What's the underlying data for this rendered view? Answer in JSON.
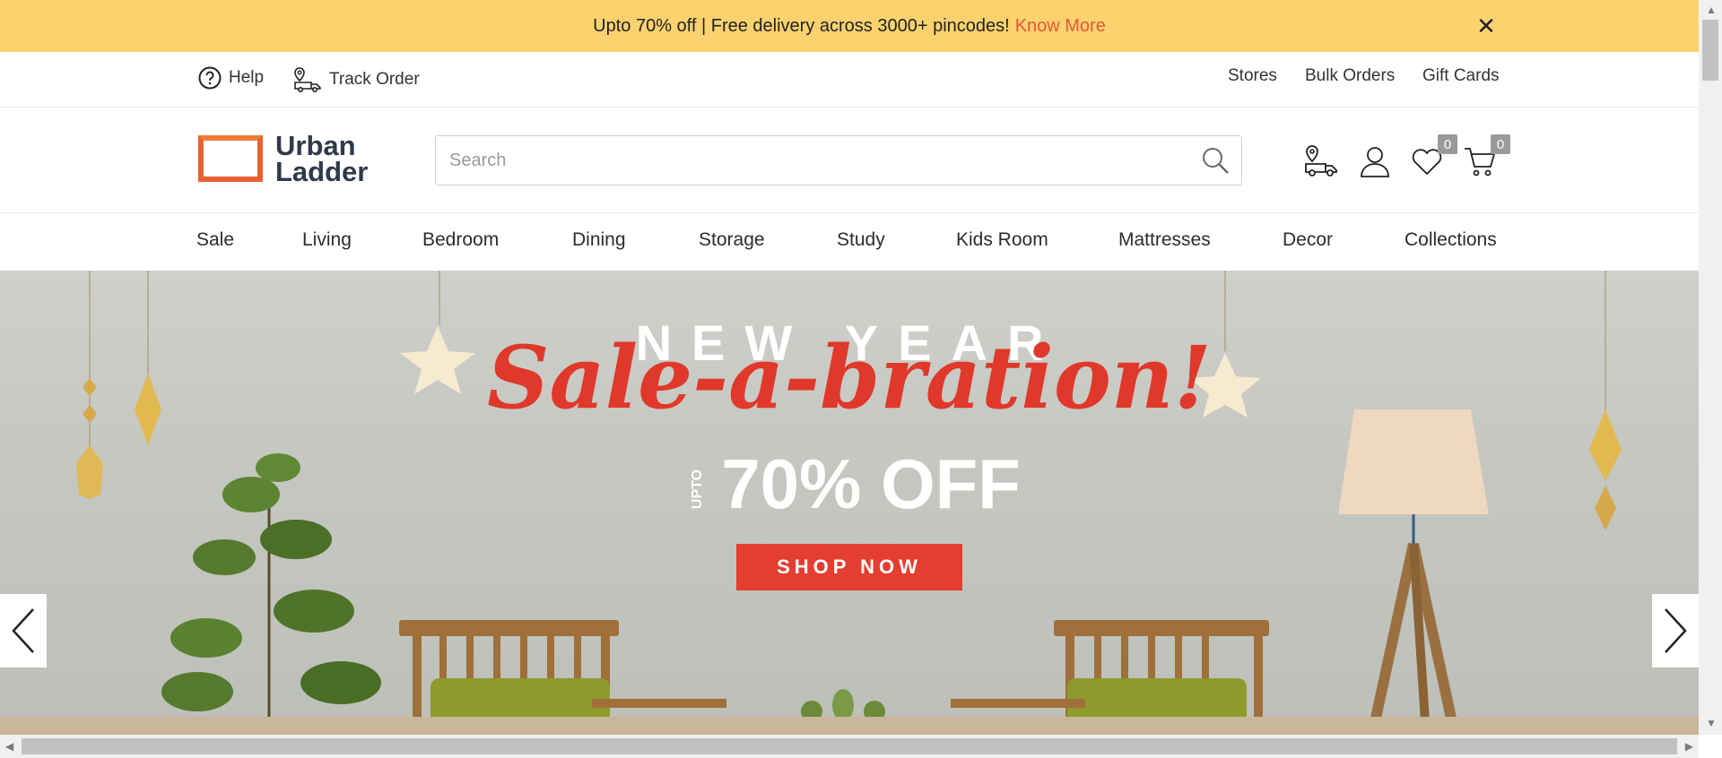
{
  "promo": {
    "text": "Upto 70% off | Free delivery across 3000+ pincodes!",
    "link": "Know More",
    "close_icon": "close-icon"
  },
  "util": {
    "help": "Help",
    "track": "Track Order",
    "stores": "Stores",
    "bulk": "Bulk Orders",
    "gift": "Gift Cards"
  },
  "header": {
    "logo_line1": "Urban",
    "logo_line2": "Ladder",
    "search_placeholder": "Search",
    "wishlist_count": "0",
    "cart_count": "0"
  },
  "nav": {
    "items": [
      "Sale",
      "Living",
      "Bedroom",
      "Dining",
      "Storage",
      "Study",
      "Kids Room",
      "Mattresses",
      "Decor",
      "Collections"
    ]
  },
  "banner": {
    "line1": "NEW YEAR",
    "line2": "Sale-a-bration!",
    "upto": "UPTO",
    "line3": "70% OFF",
    "cta": "SHOP NOW"
  },
  "colors": {
    "promo_bg": "#fcd26e",
    "accent": "#e2583b",
    "cta_bg": "#e33e2f",
    "logo_orange": "#e8622f"
  }
}
